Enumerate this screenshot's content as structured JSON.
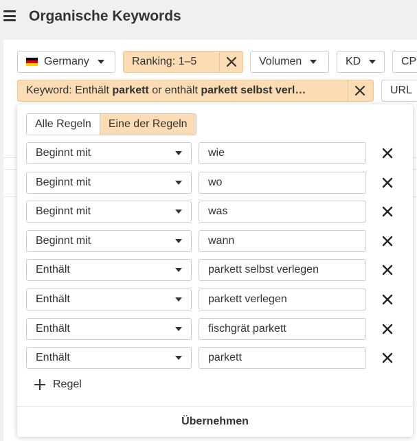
{
  "header": {
    "title": "Organische Keywords"
  },
  "toolbar": {
    "country": {
      "label": "Germany",
      "flag_colors": [
        "#000000",
        "#dd0000",
        "#ffce00"
      ]
    },
    "ranking": {
      "label": "Ranking: 1–5"
    },
    "volume": {
      "label": "Volumen"
    },
    "kd": {
      "label": "KD"
    },
    "cpc": {
      "label": "CPC"
    },
    "keyword_filter": {
      "prefix": "Keyword: Enthält ",
      "term1": "parkett",
      "middle": " or enthält ",
      "term2": "parkett selbst verl…"
    },
    "url": {
      "label": "URL"
    }
  },
  "dropdown": {
    "mode_all": "Alle Regeln",
    "mode_any": "Eine der Regeln",
    "mode_selected": "any",
    "rules": [
      {
        "operator": "Beginnt mit",
        "value": "wie"
      },
      {
        "operator": "Beginnt mit",
        "value": "wo"
      },
      {
        "operator": "Beginnt mit",
        "value": "was"
      },
      {
        "operator": "Beginnt mit",
        "value": "wann"
      },
      {
        "operator": "Enthält",
        "value": "parkett selbst verlegen"
      },
      {
        "operator": "Enthält",
        "value": "parkett verlegen"
      },
      {
        "operator": "Enthält",
        "value": "fischgrät parkett"
      },
      {
        "operator": "Enthält",
        "value": "parkett"
      }
    ],
    "add_rule_label": "Regel",
    "apply_label": "Übernehmen"
  },
  "colors": {
    "active_bg": "#fcdcb4",
    "active_border": "#f4c38d",
    "text": "#333333"
  }
}
